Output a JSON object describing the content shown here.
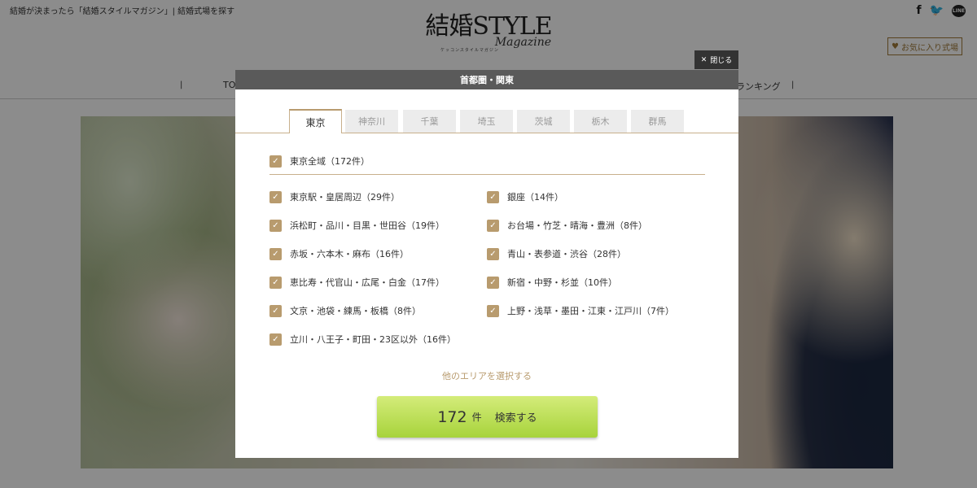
{
  "header": {
    "tagline": "結婚が決まったら「結婚スタイルマガジン」| 結婚式場を探す",
    "logo_main": "結婚STYLE",
    "logo_sub": "Magazine",
    "logo_kana": "ケッコンスタイルマガジン",
    "favorites_label": "お気に入り式場",
    "social_icons": [
      "facebook-icon",
      "twitter-icon",
      "line-icon"
    ]
  },
  "nav": {
    "left_partial": "TO",
    "right_partial": "ランキング",
    "separator": "|"
  },
  "modal": {
    "title": "首都圏・関東",
    "close_label": "閉じる",
    "tabs": [
      {
        "label": "東京",
        "active": true
      },
      {
        "label": "神奈川",
        "active": false
      },
      {
        "label": "千葉",
        "active": false
      },
      {
        "label": "埼玉",
        "active": false
      },
      {
        "label": "茨城",
        "active": false
      },
      {
        "label": "栃木",
        "active": false
      },
      {
        "label": "群馬",
        "active": false
      }
    ],
    "all_area": {
      "label": "東京全域（172件）",
      "checked": true
    },
    "areas": [
      {
        "label": "東京駅・皇居周辺（29件）",
        "checked": true
      },
      {
        "label": "銀座（14件）",
        "checked": true
      },
      {
        "label": "浜松町・品川・目黒・世田谷（19件）",
        "checked": true
      },
      {
        "label": "お台場・竹芝・晴海・豊洲（8件）",
        "checked": true
      },
      {
        "label": "赤坂・六本木・麻布（16件）",
        "checked": true
      },
      {
        "label": "青山・表参道・渋谷（28件）",
        "checked": true
      },
      {
        "label": "恵比寿・代官山・広尾・白金（17件）",
        "checked": true
      },
      {
        "label": "新宿・中野・杉並（10件）",
        "checked": true
      },
      {
        "label": "文京・池袋・練馬・板橋（8件）",
        "checked": true
      },
      {
        "label": "上野・浅草・墨田・江東・江戸川（7件）",
        "checked": true
      },
      {
        "label": "立川・八王子・町田・23区以外（16件）",
        "checked": true
      }
    ],
    "other_area_link": "他のエリアを選択する",
    "search": {
      "count": "172",
      "unit": "件",
      "label": "検索する"
    }
  },
  "colors": {
    "accent": "#b89b6e",
    "header_bar": "#5a5a5a",
    "search_button": "#b5dc4c"
  }
}
